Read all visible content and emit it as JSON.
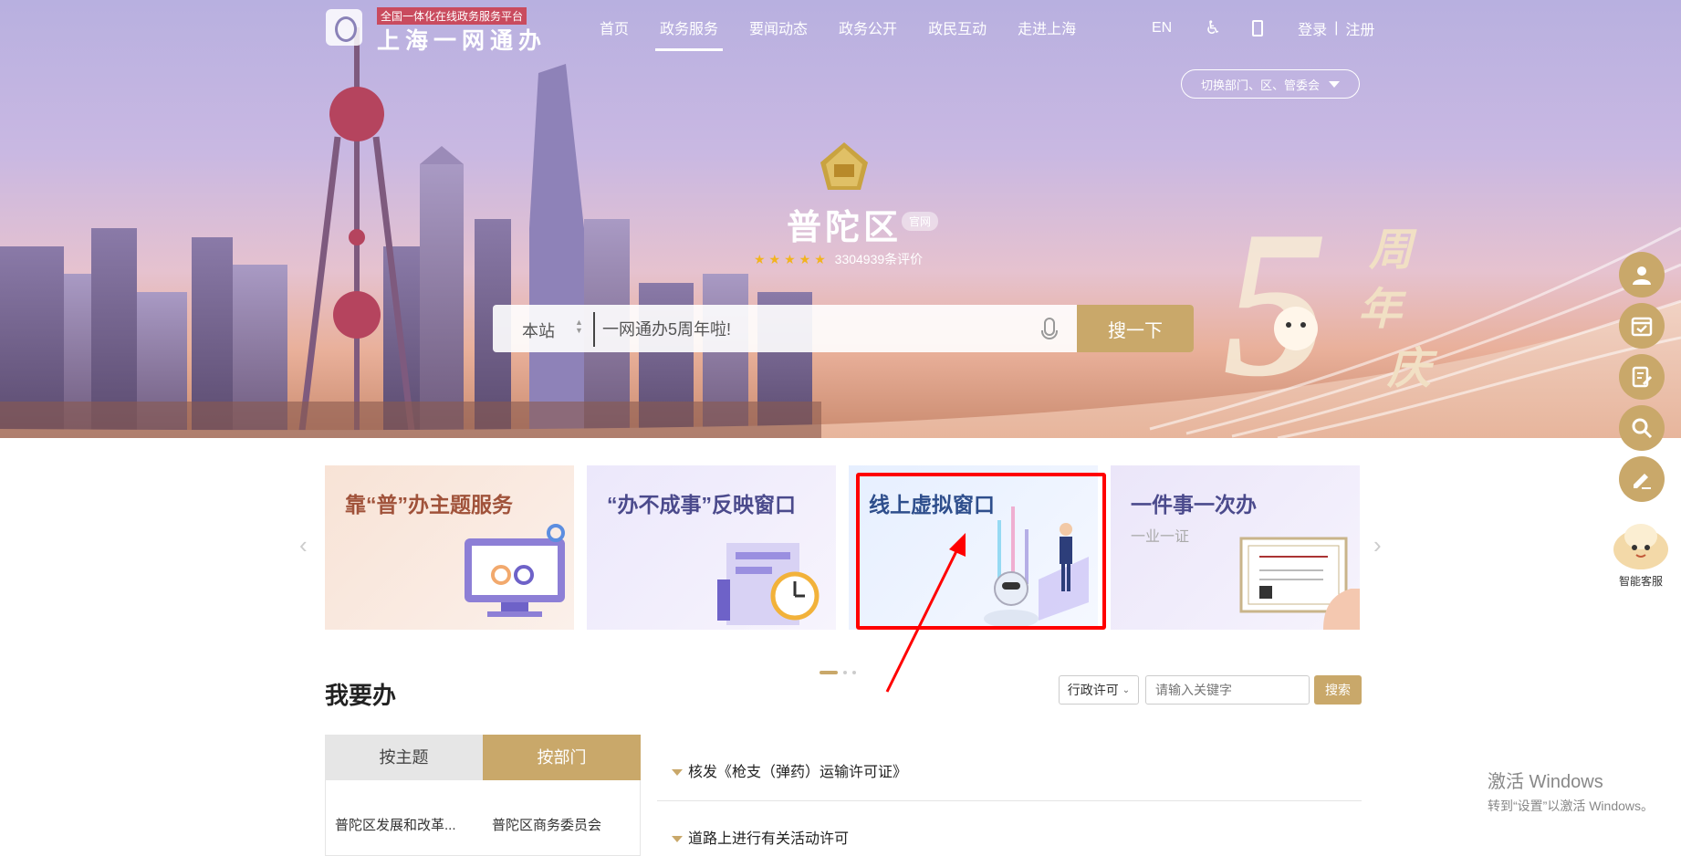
{
  "header": {
    "logo_sub": "全国一体化在线政务服务平台",
    "logo_main": "上海一网通办",
    "nav": [
      "首页",
      "政务服务",
      "要闻动态",
      "政务公开",
      "政民互动",
      "走进上海"
    ],
    "active_nav": "政务服务",
    "lang": "EN",
    "login": "登录",
    "separator": "|",
    "register": "注册",
    "switch_label": "切换部门、区、管委会"
  },
  "hero": {
    "district": "普陀区",
    "official_tag": "官网",
    "stars": "★★★★★",
    "rating_text": "3304939条评价",
    "search_scope": "本站",
    "search_placeholder": "一网通办5周年啦!",
    "search_button": "搜一下",
    "anniversary_digit": "5",
    "anniversary_text": [
      "周",
      "年",
      "庆"
    ]
  },
  "float_bar": {
    "icons": [
      "user-icon",
      "calendar-icon",
      "edit-doc-icon",
      "search-icon",
      "pen-icon"
    ],
    "ai_label": "智能客服"
  },
  "cards": [
    {
      "title": "靠“普”办主题服务",
      "color": "#a0523a"
    },
    {
      "title": "“办不成事”反映窗口",
      "color": "#4b4a8c"
    },
    {
      "title": "线上虚拟窗口",
      "color": "#2e4e8c"
    },
    {
      "title": "一件事一次办",
      "sub": "一业一证",
      "color": "#4b4a8c"
    }
  ],
  "main": {
    "section_title": "我要办",
    "filter_select": "行政许可",
    "filter_placeholder": "请输入关键字",
    "filter_button": "搜索",
    "tabs": [
      "按主题",
      "按部门"
    ],
    "departments": [
      "普陀区发展和改革...",
      "普陀区商务委员会"
    ],
    "services": [
      "核发《枪支（弹药）运输许可证》",
      "道路上进行有关活动许可"
    ]
  },
  "watermark": {
    "title": "激活 Windows",
    "sub": "转到“设置”以激活 Windows。"
  },
  "colors": {
    "gold": "#c9a86a",
    "highlight": "#ff0000"
  }
}
